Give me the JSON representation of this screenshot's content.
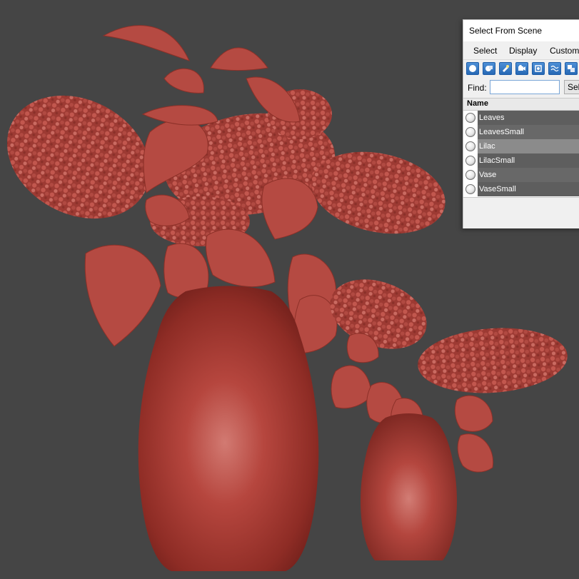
{
  "window": {
    "title": "Select From Scene"
  },
  "menu": [
    {
      "label": "Select"
    },
    {
      "label": "Display"
    },
    {
      "label": "Customize"
    }
  ],
  "toolbar": {
    "icons": [
      "sphere-filter-icon",
      "shapes-filter-icon",
      "lights-filter-icon",
      "cameras-filter-icon",
      "helpers-filter-icon",
      "spacewarps-filter-icon",
      "groups-filter-icon"
    ],
    "accent": "#2b6fbf"
  },
  "find": {
    "label": "Find:",
    "value": "",
    "select_button": "Select"
  },
  "list": {
    "header": "Name",
    "items": [
      {
        "label": "Leaves"
      },
      {
        "label": "LeavesSmall"
      },
      {
        "label": "Lilac",
        "selected": true
      },
      {
        "label": "LilacSmall"
      },
      {
        "label": "Vase"
      },
      {
        "label": "VaseSmall"
      }
    ]
  },
  "scene": {
    "background": "#454545",
    "material": "#b8473f"
  }
}
